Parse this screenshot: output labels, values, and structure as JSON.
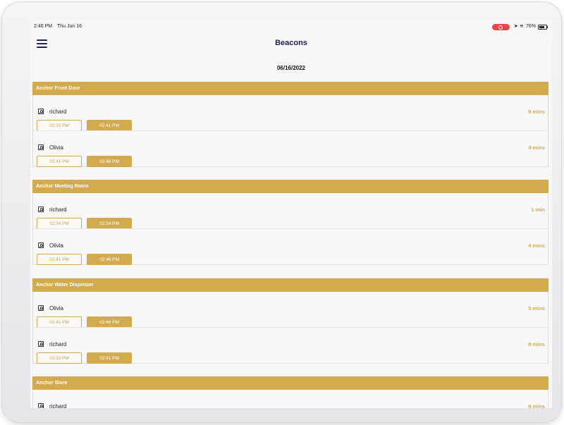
{
  "status_bar": {
    "time": "2:46 PM",
    "date": "Thu Jun 16",
    "battery_percent": "76%",
    "battery_level": 0.76
  },
  "header": {
    "title": "Beacons",
    "date": "06/16/2022"
  },
  "colors": {
    "accent": "#d4aa4f",
    "title": "#1c2350",
    "record": "#e8474a"
  },
  "sections": [
    {
      "name": "Anchor Front Door",
      "entries": [
        {
          "user": "richard",
          "time_in": "02:33 PM",
          "time_out": "02:41 PM",
          "duration": "8 mins"
        },
        {
          "user": "Olivia",
          "time_in": "02:41 PM",
          "time_out": "02:46 PM",
          "duration": "4 mins"
        }
      ]
    },
    {
      "name": "Anchor Meeting Room",
      "entries": [
        {
          "user": "richard",
          "time_in": "02:34 PM",
          "time_out": "02:34 PM",
          "duration": "1 min"
        },
        {
          "user": "Olivia",
          "time_in": "02:41 PM",
          "time_out": "02:46 PM",
          "duration": "4 mins"
        }
      ]
    },
    {
      "name": "Anchor Water Dispenser",
      "entries": [
        {
          "user": "Olivia",
          "time_in": "02:41 PM",
          "time_out": "02:46 PM",
          "duration": "5 mins"
        },
        {
          "user": "richard",
          "time_in": "02:33 PM",
          "time_out": "02:41 PM",
          "duration": "8 mins"
        }
      ]
    },
    {
      "name": "Anchor Store",
      "entries": [
        {
          "user": "richard",
          "time_in": "",
          "time_out": "",
          "duration": "6 mins"
        }
      ]
    }
  ]
}
